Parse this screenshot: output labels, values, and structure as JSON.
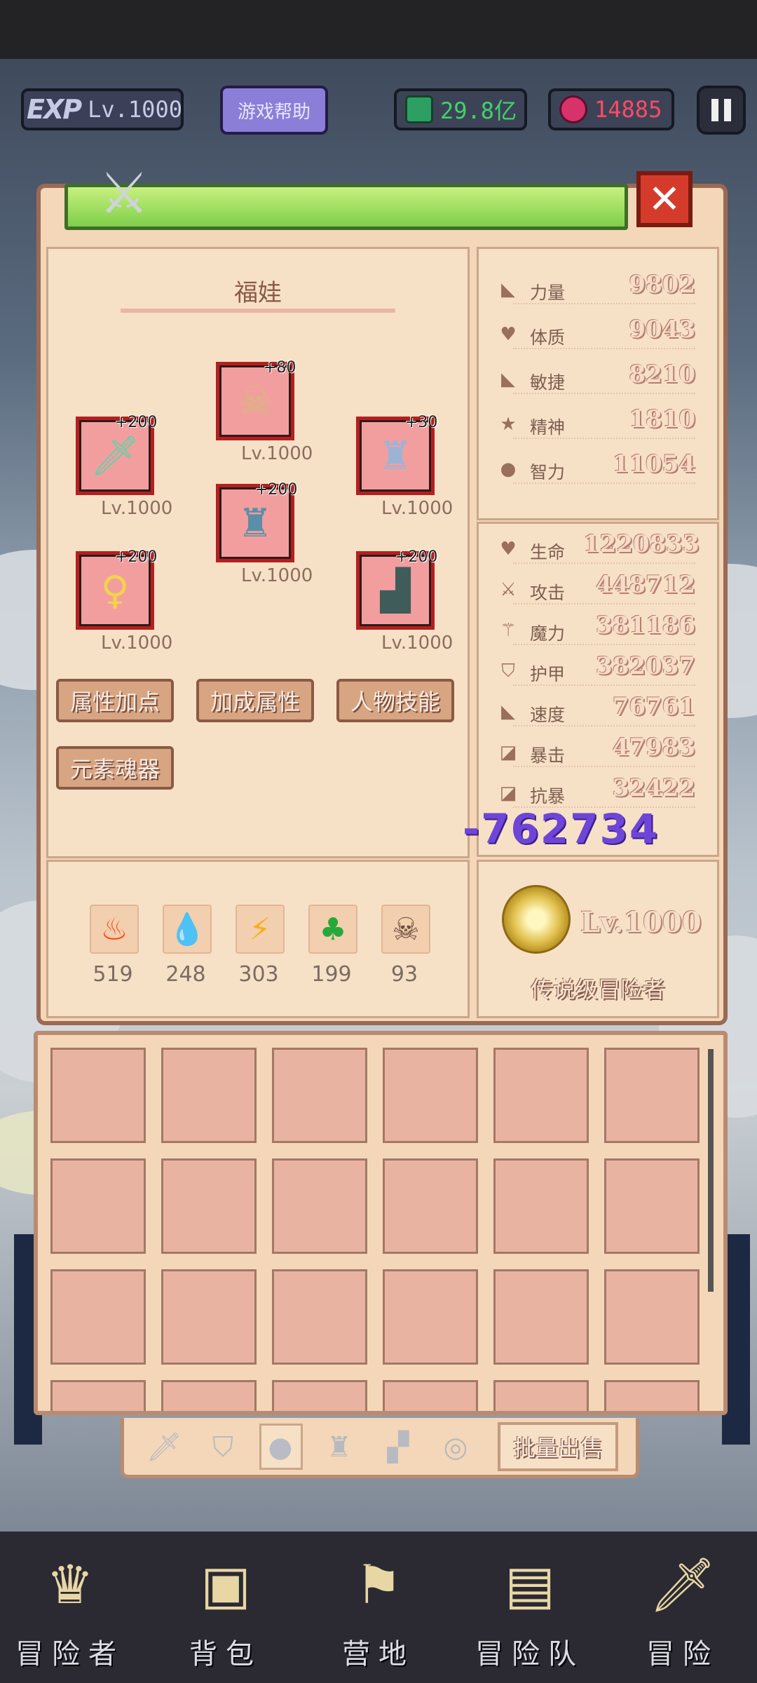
{
  "topbar": {
    "exp_label": "EXP",
    "player_level": "Lv.1000",
    "help_label": "游戏帮助",
    "gems": "29.8亿",
    "rubies": "14885",
    "gem_icon": "green-gem-icon",
    "ruby_icon": "red-gem-icon"
  },
  "character": {
    "name": "福娃",
    "equipment": [
      {
        "slot": "weapon",
        "icon": "sword-icon",
        "bonus": "+200",
        "level": "Lv.1000"
      },
      {
        "slot": "helmet",
        "icon": "helmet-icon",
        "bonus": "+80",
        "level": "Lv.1000"
      },
      {
        "slot": "armor-light",
        "icon": "light-armor-icon",
        "bonus": "+30",
        "level": "Lv.1000"
      },
      {
        "slot": "armor",
        "icon": "armor-icon",
        "bonus": "+200",
        "level": "Lv.1000"
      },
      {
        "slot": "amulet",
        "icon": "amulet-icon",
        "bonus": "+200",
        "level": "Lv.1000"
      },
      {
        "slot": "boots",
        "icon": "boots-icon",
        "bonus": "+200",
        "level": "Lv.1000"
      }
    ],
    "buttons": [
      "属性加点",
      "加成属性",
      "人物技能",
      "元素魂器"
    ]
  },
  "elements": [
    {
      "name": "fire",
      "icon": "fire-icon",
      "value": "519"
    },
    {
      "name": "water",
      "icon": "water-drop-icon",
      "value": "248"
    },
    {
      "name": "thunder",
      "icon": "lightning-icon",
      "value": "303"
    },
    {
      "name": "wood",
      "icon": "leaf-icon",
      "value": "199"
    },
    {
      "name": "dark",
      "icon": "skull-icon",
      "value": "93"
    }
  ],
  "base_stats": [
    {
      "label": "力量",
      "value": "9802"
    },
    {
      "label": "体质",
      "value": "9043"
    },
    {
      "label": "敏捷",
      "value": "8210"
    },
    {
      "label": "精神",
      "value": "1810"
    },
    {
      "label": "智力",
      "value": "11054"
    }
  ],
  "combat_stats": [
    {
      "label": "生命",
      "value": "1220833"
    },
    {
      "label": "攻击",
      "value": "448712"
    },
    {
      "label": "魔力",
      "value": "381186"
    },
    {
      "label": "护甲",
      "value": "382037"
    },
    {
      "label": "速度",
      "value": "76761"
    },
    {
      "label": "暴击",
      "value": "47983"
    },
    {
      "label": "抗暴",
      "value": "32422"
    }
  ],
  "floating_damage": "-762734",
  "rank": {
    "level": "Lv.1000",
    "title": "传说级冒险者"
  },
  "inventory": {
    "bulk_sell": "批量出售",
    "tabs": [
      "weapon-tab",
      "shield-tab",
      "helmet-tab",
      "armor-tab",
      "pants-tab",
      "ring-tab"
    ]
  },
  "nav": [
    {
      "label": "冒险者",
      "icon": "crown-icon"
    },
    {
      "label": "背包",
      "icon": "backpack-icon"
    },
    {
      "label": "营地",
      "icon": "camp-icon"
    },
    {
      "label": "冒险队",
      "icon": "team-icon"
    },
    {
      "label": "冒险",
      "icon": "dagger-icon"
    }
  ]
}
